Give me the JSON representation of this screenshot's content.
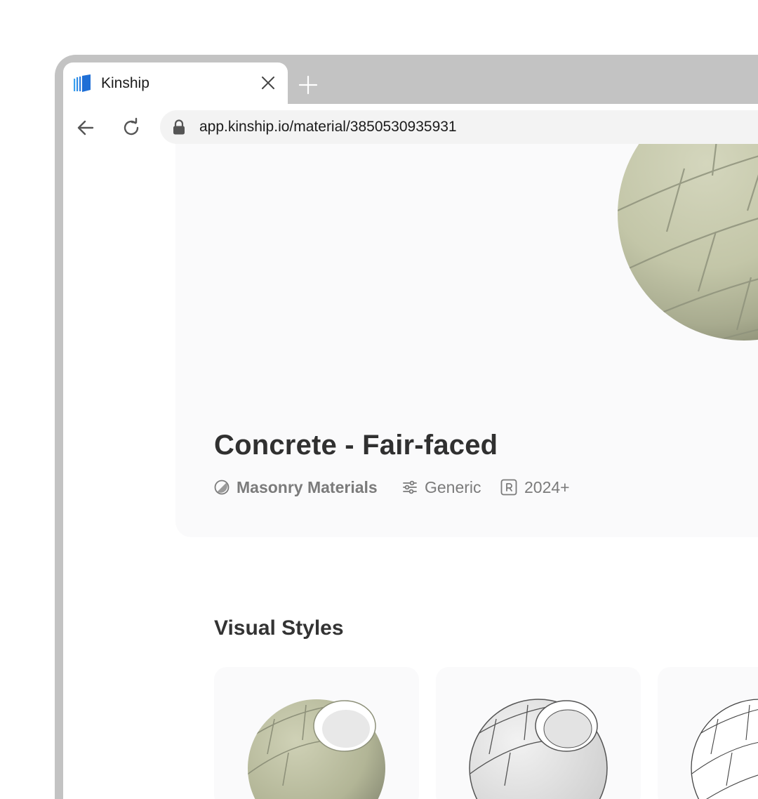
{
  "browser": {
    "tab": {
      "title": "Kinship",
      "logo_icon": "kinship-logo-icon",
      "close_icon": "close-icon"
    },
    "new_tab_icon": "plus-icon",
    "nav": {
      "back_icon": "arrow-left-icon",
      "reload_icon": "reload-icon"
    },
    "address_bar": {
      "lock_icon": "lock-icon",
      "url": "app.kinship.io/material/3850530935931"
    }
  },
  "material": {
    "title": "Concrete - Fair-faced",
    "category": {
      "label": "Masonry Materials",
      "icon": "material-category-icon"
    },
    "type": {
      "label": "Generic",
      "icon": "sliders-icon"
    },
    "version": {
      "label": "2024+",
      "icon": "revit-r-icon"
    }
  },
  "visual_styles": {
    "title": "Visual Styles",
    "cards": [
      "realistic",
      "shaded",
      "wireframe"
    ]
  },
  "colors": {
    "brand_blue": "#1f6fd6",
    "frame_gray": "#c3c3c3",
    "concrete": "#c5c8ab"
  }
}
